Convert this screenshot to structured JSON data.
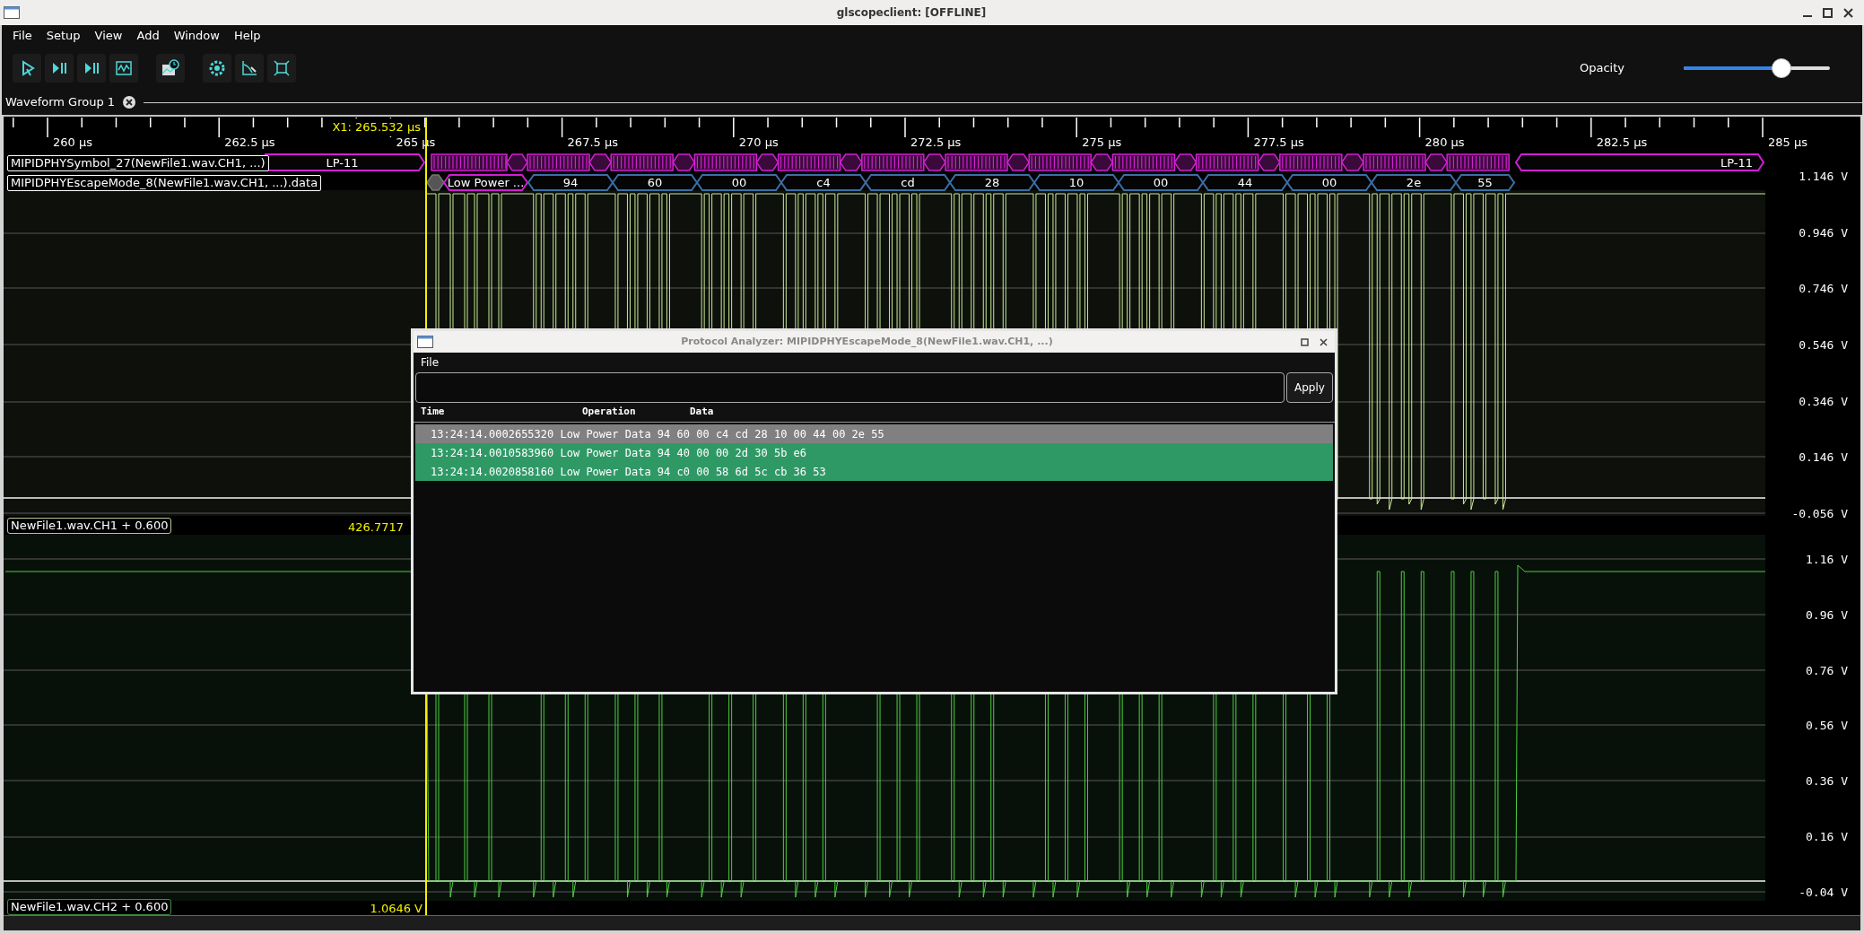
{
  "window": {
    "title": "glscopeclient: [OFFLINE]"
  },
  "menu": [
    "File",
    "Setup",
    "View",
    "Add",
    "Window",
    "Help"
  ],
  "toolbar": {
    "opacity": {
      "label": "Opacity",
      "level": 0.72
    }
  },
  "tabs": [
    {
      "label": "Waveform Group 1",
      "selected": true
    }
  ],
  "timeline": {
    "cursor_label": "X1: 265.532 µs",
    "ticks": [
      "260 µs",
      "262.5 µs",
      "265 µs",
      "267.5 µs",
      "270 µs",
      "272.5 µs",
      "275 µs",
      "277.5 µs",
      "280 µs",
      "282.5 µs",
      "285 µs"
    ]
  },
  "protocol_rows": [
    {
      "label": "MIPIDPHYSymbol_27(NewFile1.wav.CH1, ...)",
      "start_state": "LP-11",
      "end_state": "LP-11"
    },
    {
      "label": "MIPIDPHYEscapeMode_8(NewFile1.wav.CH1, ...).data",
      "segments": [
        {
          "kind": "mode",
          "text": "Low Power ..."
        },
        {
          "kind": "byte",
          "text": "94"
        },
        {
          "kind": "byte",
          "text": "60"
        },
        {
          "kind": "byte",
          "text": "00"
        },
        {
          "kind": "byte",
          "text": "c4"
        },
        {
          "kind": "byte",
          "text": "cd"
        },
        {
          "kind": "byte",
          "text": "28"
        },
        {
          "kind": "byte",
          "text": "10"
        },
        {
          "kind": "byte",
          "text": "00"
        },
        {
          "kind": "byte",
          "text": "44"
        },
        {
          "kind": "byte",
          "text": "00"
        },
        {
          "kind": "byte",
          "text": "2e"
        },
        {
          "kind": "byte",
          "text": "55"
        }
      ]
    }
  ],
  "channels": [
    {
      "label": "NewFile1.wav.CH1 + 0.600",
      "reading": "426.7717",
      "axis": [
        "1.146 V",
        "0.946 V",
        "0.746 V",
        "0.546 V",
        "0.346 V",
        "0.146 V",
        "-0.056 V"
      ]
    },
    {
      "label": "NewFile1.wav.CH2 + 0.600",
      "reading": "1.0646 V",
      "axis": [
        "1.16 V",
        "0.96 V",
        "0.76 V",
        "0.56 V",
        "0.36 V",
        "0.16 V",
        "-0.04 V"
      ]
    }
  ],
  "dialog": {
    "title": "Protocol Analyzer: MIPIDPHYEscapeMode_8(NewFile1.wav.CH1, ...)",
    "menu": [
      "File"
    ],
    "filter": {
      "button": "Apply"
    },
    "columns": [
      "Time",
      "Operation",
      "Data"
    ],
    "rows": [
      {
        "time": "13:24:14.0002655320",
        "operation": "Low Power Data",
        "data": "94 60 00 c4 cd 28 10 00 44 00 2e 55",
        "selected": true
      },
      {
        "time": "13:24:14.0010583960",
        "operation": "Low Power Data",
        "data": "94 40 00 00 2d 30 5b e6",
        "selected": false
      },
      {
        "time": "13:24:14.0020858160",
        "operation": "Low Power Data",
        "data": "94 c0 00 58 6d 5c cb 36 53",
        "selected": false
      }
    ]
  }
}
